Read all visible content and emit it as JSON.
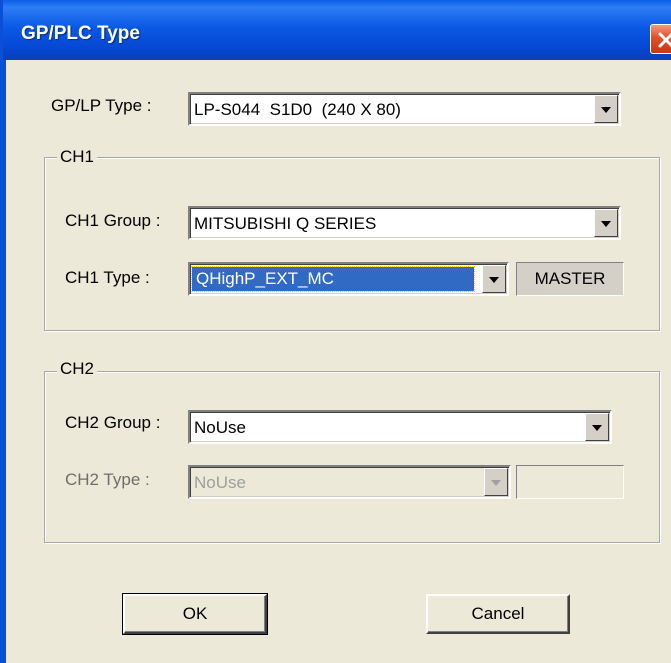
{
  "window": {
    "title": "GP/PLC Type"
  },
  "gp_lp": {
    "label": "GP/LP Type :",
    "value": "LP-S044  S1D0  (240 X 80)"
  },
  "ch1": {
    "caption": "CH1",
    "group_label": "CH1 Group :",
    "group_value": "MITSUBISHI Q SERIES",
    "type_label": "CH1 Type :",
    "type_value": "QHighP_EXT_MC",
    "role": "MASTER"
  },
  "ch2": {
    "caption": "CH2",
    "group_label": "CH2 Group :",
    "group_value": "NoUse",
    "type_label": "CH2 Type :",
    "type_value": "NoUse",
    "role": ""
  },
  "buttons": {
    "ok": "OK",
    "cancel": "Cancel"
  },
  "colors": {
    "titlebar": "#0548D4",
    "dialog_bg": "#ECE9D8",
    "selection": "#316AC5",
    "close": "#E0502A"
  }
}
